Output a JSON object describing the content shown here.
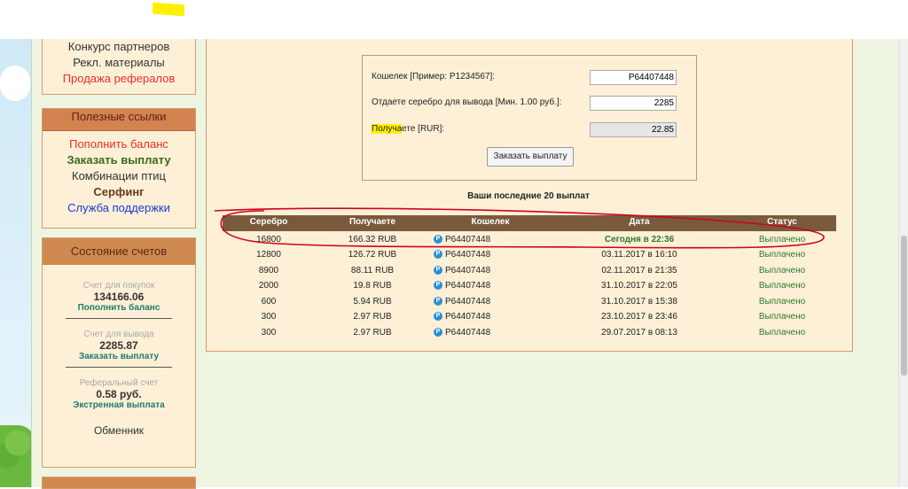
{
  "nav_top": [
    "Конкурс партнеров",
    "Рекл. материалы",
    "Продажа рефералов"
  ],
  "useful_links": {
    "header": "Полезные ссылки",
    "items": [
      "Пополнить баланс",
      "Заказать выплату",
      "Комбинации птиц",
      "Серфинг",
      "Служба поддержки"
    ]
  },
  "accounts": {
    "header": "Состояние счетов",
    "purchase": {
      "caption": "Счет для покупок",
      "value": "134166.06",
      "link": "Пополнить баланс"
    },
    "withdraw": {
      "caption": "Счет для вывода",
      "value": "2285.87",
      "link": "Заказать выплату"
    },
    "referral": {
      "caption": "Реферальный счет",
      "value": "0.58 руб.",
      "link": "Экстренная выплата"
    },
    "exchanger": "Обменник"
  },
  "form": {
    "wallet_label": "Кошелек [Пример: P1234567]:",
    "wallet_value": "P64407448",
    "silver_label": "Отдаете серебро для вывода [Мин. 1.00 руб.]:",
    "silver_value": "2285",
    "receive_label_hl": "Получа",
    "receive_label_rest": "ете [RUR]:",
    "receive_value": "22.85",
    "submit": "Заказать выплату"
  },
  "history": {
    "title": "Ваши последние 20 выплат",
    "columns": [
      "Серебро",
      "Получаете",
      "Кошелек",
      "Дата",
      "Статус"
    ],
    "rows": [
      {
        "silver": "16800",
        "receive": "166.32 RUB",
        "wallet": "P64407448",
        "date": "Сегодня в 22:36",
        "status": "Выплачено"
      },
      {
        "silver": "12800",
        "receive": "126.72 RUB",
        "wallet": "P64407448",
        "date": "03.11.2017 в 16:10",
        "status": "Выплачено"
      },
      {
        "silver": "8900",
        "receive": "88.11 RUB",
        "wallet": "P64407448",
        "date": "02.11.2017 в 21:35",
        "status": "Выплачено"
      },
      {
        "silver": "2000",
        "receive": "19.8 RUB",
        "wallet": "P64407448",
        "date": "31.10.2017 в 22:05",
        "status": "Выплачено"
      },
      {
        "silver": "600",
        "receive": "5.94 RUB",
        "wallet": "P64407448",
        "date": "31.10.2017 в 15:38",
        "status": "Выплачено"
      },
      {
        "silver": "300",
        "receive": "2.97 RUB",
        "wallet": "P64407448",
        "date": "23.10.2017 в 23:46",
        "status": "Выплачено"
      },
      {
        "silver": "300",
        "receive": "2.97 RUB",
        "wallet": "P64407448",
        "date": "29.07.2017 в 08:13",
        "status": "Выплачено"
      }
    ]
  },
  "icons": {
    "payeer": "payeer-p-icon"
  },
  "colors": {
    "accent": "#d3834f",
    "table_header": "#7a5a3c",
    "paid": "#2c7a2c",
    "annotation": "#d0021b"
  }
}
